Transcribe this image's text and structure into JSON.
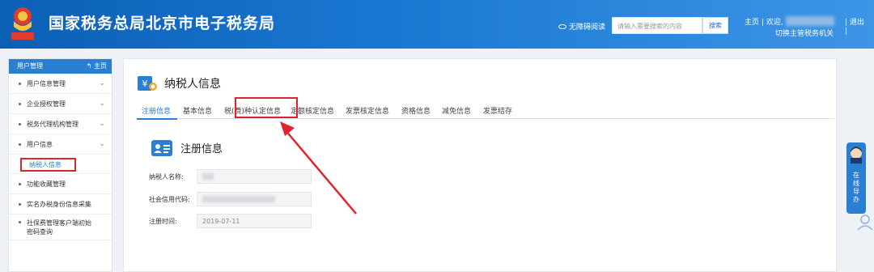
{
  "header": {
    "emblem_text": "中国税务",
    "title": "国家税务总局北京市电子税务局",
    "accessibility_label": "无障碍阅读",
    "search_placeholder": "请输入需要搜索的内容",
    "search_button": "搜索",
    "home_link": "主页",
    "separator": "|",
    "welcome": "欢迎,",
    "switch_org": "切换主管税务机关",
    "logout": "退出"
  },
  "sidebar": {
    "header_label": "用户管理",
    "home_label": "主页",
    "items": [
      {
        "label": "用户信息管理",
        "expandable": true
      },
      {
        "label": "企业授权管理",
        "expandable": true
      },
      {
        "label": "税务代理机构管理",
        "expandable": true
      },
      {
        "label": "用户信息",
        "expandable": true
      },
      {
        "label": "纳税人信息",
        "sub": true,
        "selected": true
      },
      {
        "label": "功能收藏管理"
      },
      {
        "label": "实名办税身份信息采集"
      },
      {
        "label": "社保费管理客户端初始密码查询"
      }
    ]
  },
  "main": {
    "page_title": "纳税人信息",
    "tabs": [
      {
        "label": "注册信息",
        "active": true
      },
      {
        "label": "基本信息"
      },
      {
        "label": "税(费)种认定信息",
        "highlighted": true
      },
      {
        "label": "定额核定信息"
      },
      {
        "label": "发票核定信息"
      },
      {
        "label": "资格信息"
      },
      {
        "label": "减免信息"
      },
      {
        "label": "发票结存"
      }
    ],
    "section_title": "注册信息",
    "fields": [
      {
        "label": "纳税人名称:",
        "value": ""
      },
      {
        "label": "社会信用代码:",
        "value": ""
      },
      {
        "label": "注册时间:",
        "value": "2019-07-11"
      }
    ]
  },
  "float": {
    "guide_label": "在线导办"
  },
  "colors": {
    "brand_blue": "#2b7fd0",
    "header_start": "#0b5fb5",
    "annotation_red": "#e0242c"
  }
}
